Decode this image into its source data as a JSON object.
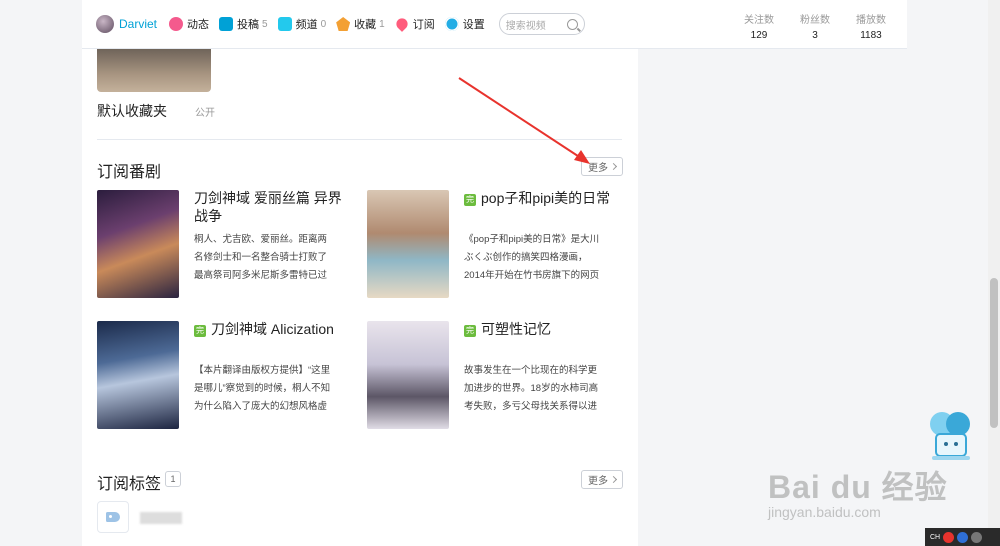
{
  "topbar": {
    "username": "Darviet",
    "nav": [
      {
        "label": "动态",
        "count": "",
        "color": "#f45a8d"
      },
      {
        "label": "投稿",
        "count": "5",
        "color": "#00a1d6"
      },
      {
        "label": "频道",
        "count": "0",
        "color": "#23c9ed"
      },
      {
        "label": "收藏",
        "count": "1",
        "color": "#f3a034"
      },
      {
        "label": "订阅",
        "count": "",
        "color": "#ff5c7c"
      },
      {
        "label": "设置",
        "count": "",
        "color": "#23ade5"
      }
    ],
    "search_placeholder": "搜索视频",
    "stats": [
      {
        "label": "关注数",
        "value": "129"
      },
      {
        "label": "粉丝数",
        "value": "3"
      },
      {
        "label": "播放数",
        "value": "1183"
      }
    ]
  },
  "favorites": {
    "name": "默认收藏夹",
    "status": "公开"
  },
  "bangumi": {
    "title": "订阅番剧",
    "more": "更多",
    "items": [
      {
        "title": "刀剑神域 爱丽丝篇 异界战争",
        "badge": "",
        "desc": "桐人、尤吉欧、爱丽丝。距离两名修剑士和一名整合骑士打败了最高祭司阿多米尼斯多雷特已过去半"
      },
      {
        "title": "pop子和pipi美的日常",
        "badge": "完",
        "desc": "《pop子和pipi美的日常》是大川ぶくぶ创作的搞笑四格漫画，2014年开始在竹书房旗下的网页漫画网..."
      },
      {
        "title": "刀剑神域 Alicization",
        "badge": "完",
        "desc": "【本片翻译由版权方提供】“这里是哪儿”察觉到的时候，桐人不知为什么陷入了庞大的幻想风格虚拟"
      },
      {
        "title": "可塑性记忆",
        "badge": "完",
        "desc": "故事发生在一个比现在的科学更加进步的世界。18岁的水柿司高考失败，多亏父母找关系得以进入大企"
      }
    ]
  },
  "tags": {
    "title": "订阅标签",
    "count": "1",
    "more": "更多"
  },
  "watermark": {
    "main": "Bai du 经验",
    "sub": "jingyan.baidu.com"
  },
  "taskbar": {
    "lang": "CH"
  },
  "colors": {
    "accent": "#00a1d6",
    "badge": "#6cbc3e",
    "arrow": "#e8332d"
  }
}
